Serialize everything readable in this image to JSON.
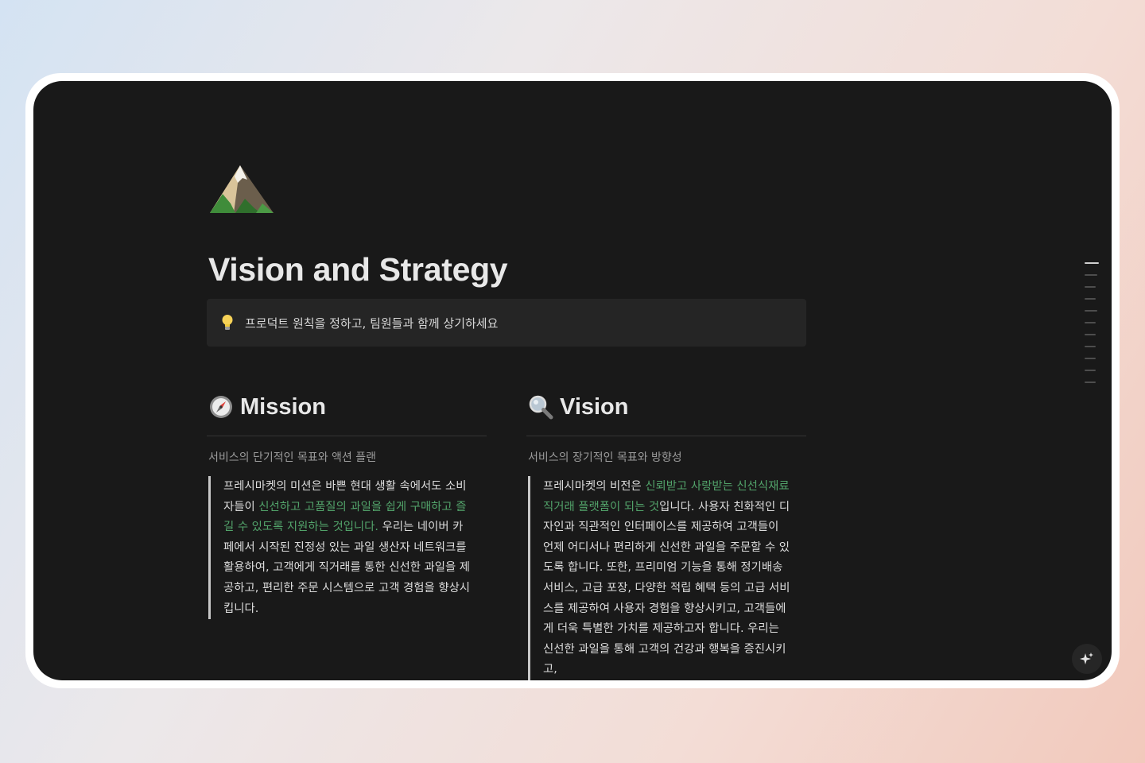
{
  "page": {
    "title": "Vision and Strategy",
    "icon": "mountain-icon",
    "callout": {
      "icon": "lightbulb-icon",
      "text": "프로덕트 원칙을 정하고, 팀원들과 함께 상기하세요"
    }
  },
  "mission": {
    "icon": "compass-icon",
    "title": "Mission",
    "subtitle": "서비스의 단기적인 목표와 액션 플랜",
    "body_before": "프레시마켓의 미션은 바쁜 현대 생활 속에서도 소비자들이 ",
    "body_highlight": "신선하고 고품질의 과일을 쉽게 구매하고 즐길 수 있도록 지원하는 것입니다.",
    "body_after": " 우리는 네이버 카페에서 시작된 진정성 있는 과일 생산자 네트워크를 활용하여, 고객에게 직거래를 통한 신선한 과일을 제공하고, 편리한 주문 시스템으로 고객 경험을 향상시킵니다."
  },
  "vision": {
    "icon": "magnifier-icon",
    "title": "Vision",
    "subtitle": "서비스의 장기적인 목표와 방향성",
    "body_before": "프레시마켓의 비전은 ",
    "body_highlight": "신뢰받고 사랑받는 신선식재료 직거래 플랫폼이 되는 것",
    "body_after": "입니다. 사용자 친화적인 디자인과 직관적인 인터페이스를 제공하여 고객들이 언제 어디서나 편리하게 신선한 과일을 주문할 수 있도록 합니다. 또한, 프리미엄 기능을 통해 정기배송 서비스, 고급 포장, 다양한 적립 혜택 등의 고급 서비스를 제공하여 사용자 경험을 향상시키고, 고객들에게 더욱 특별한 가치를 제공하고자 합니다. 우리는 신선한 과일을 통해 고객의 건강과 행복을 증진시키고,"
  },
  "colors": {
    "background": "#191919",
    "text": "#e8e8e8",
    "highlight": "#52a36a",
    "callout_bg": "#252525"
  },
  "ai_button": {
    "icon": "sparkle-icon"
  }
}
